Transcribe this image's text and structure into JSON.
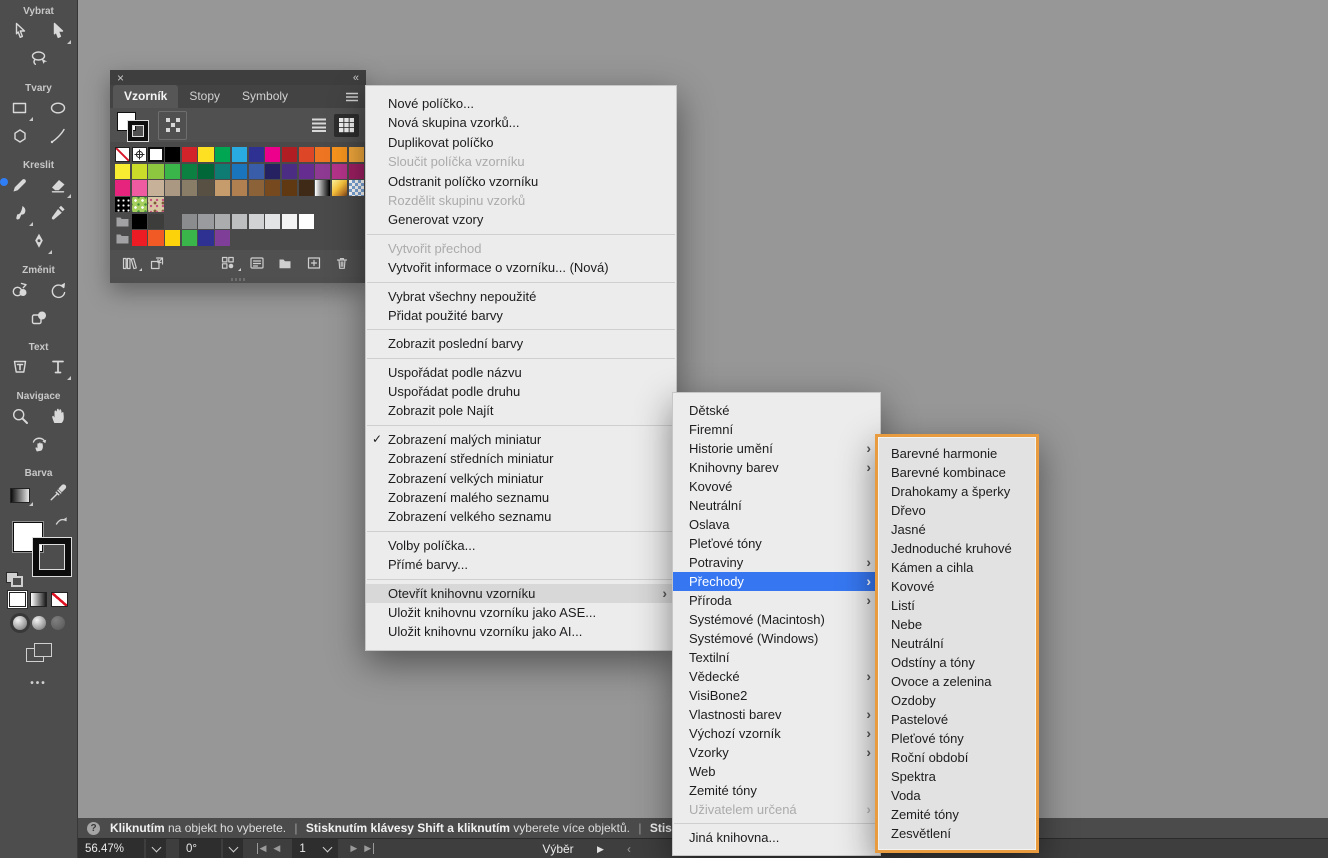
{
  "glyphs": {
    "close": "×",
    "collapse": "«",
    "check": "✓",
    "submenu_arrow": "›",
    "more_dots": "•••",
    "help": "?",
    "play": "▶",
    "back": "‹",
    "prev": "◀",
    "next": "▶"
  },
  "colors": {
    "accent_blue": "#3677f1",
    "highlight_orange": "#e89b3f",
    "canvas": "#979797",
    "chrome": "#4d4d4d",
    "menu_bg": "#ececec"
  },
  "toolbar": {
    "sections": [
      {
        "label": "Vybrat",
        "tools": [
          {
            "name": "direct-selection"
          },
          {
            "name": "selection",
            "corner": true
          },
          {
            "name": "lasso"
          }
        ]
      },
      {
        "label": "Tvary",
        "tools": [
          {
            "name": "rectangle",
            "corner": true
          },
          {
            "name": "ellipse"
          },
          {
            "name": "polygon"
          },
          {
            "name": "line"
          }
        ]
      },
      {
        "label": "Kreslit",
        "tools": [
          {
            "name": "pencil",
            "badge": true
          },
          {
            "name": "eraser",
            "corner": true
          },
          {
            "name": "paintbrush",
            "corner": true
          },
          {
            "name": "fountain-pen"
          },
          {
            "name": "pen",
            "corner": true
          }
        ]
      },
      {
        "label": "Změnit",
        "tools": [
          {
            "name": "shape-builder"
          },
          {
            "name": "rotate"
          },
          {
            "name": "transform"
          }
        ]
      },
      {
        "label": "Text",
        "tools": [
          {
            "name": "touch-type"
          },
          {
            "name": "type",
            "corner": true
          }
        ]
      },
      {
        "label": "Navigace",
        "tools": [
          {
            "name": "zoom"
          },
          {
            "name": "hand"
          },
          {
            "name": "rotate-view"
          }
        ]
      },
      {
        "label": "Barva",
        "tools": [
          {
            "name": "gradient",
            "corner": true
          },
          {
            "name": "eyedropper"
          }
        ]
      }
    ]
  },
  "panel": {
    "tabs": [
      {
        "label": "Vzorník",
        "active": true
      },
      {
        "label": "Stopy",
        "active": false
      },
      {
        "label": "Symboly",
        "active": false
      }
    ],
    "swatch_rows": [
      [
        "none",
        "registration",
        "selected-white",
        "#000000",
        "#d2232a",
        "#fde021",
        "#00a651",
        "#29abe2",
        "#2e3192",
        "#ec008c",
        "#b01e24",
        "#dd4727",
        "#ee7623",
        "#f7941d",
        "#f2a83b"
      ],
      [
        "#f9ed32",
        "#cbdb2a",
        "#8dc63f",
        "#39b54a",
        "#0c8040",
        "#006838",
        "#0f7c74",
        "#1b75bc",
        "#3a5da9",
        "#262262",
        "#4b2d83",
        "#662d91",
        "#8e3a93",
        "#b4338a",
        "#9e1f63"
      ],
      [
        "#e6247e",
        "#ef5ba1",
        "#c7b299",
        "#ab9882",
        "#8a7d68",
        "#575043",
        "#c69c6d",
        "#b08050",
        "#8c6239",
        "#77491f",
        "#603913",
        "#3f2a17",
        "gradient-bw",
        "gradient-gold",
        "pattern-blue"
      ],
      [
        "pattern-dots",
        "pattern-green",
        "pattern-floral",
        "",
        "",
        "",
        "",
        "",
        "",
        "",
        "",
        "",
        "",
        "",
        ""
      ],
      [
        "folder",
        "#000000",
        "#3d3d3c",
        "",
        "#8a8c8e",
        "#999b9e",
        "#aaacae",
        "#bcbec0",
        "#d0d2d3",
        "#e3e4e5",
        "#f3f3f3",
        "#ffffff",
        "",
        "",
        ""
      ],
      [
        "folder",
        "#ed1c24",
        "#f15a24",
        "#fcd20b",
        "#39b54a",
        "#2e3192",
        "#7f3f98",
        "",
        "",
        "",
        "",
        "",
        "",
        "",
        ""
      ]
    ],
    "footer_icons": [
      {
        "name": "swatch-libraries",
        "corner": true
      },
      {
        "name": "import-swatches",
        "corner": false
      },
      {
        "name": "swatch-kinds",
        "corner": true,
        "gap": true
      },
      {
        "name": "swatch-options",
        "corner": false
      },
      {
        "name": "new-color-group",
        "corner": false
      },
      {
        "name": "new-swatch",
        "corner": false
      },
      {
        "name": "delete-swatch",
        "corner": false
      }
    ]
  },
  "menu": {
    "items": [
      {
        "label": "Nové políčko..."
      },
      {
        "label": "Nová skupina vzorků..."
      },
      {
        "label": "Duplikovat políčko"
      },
      {
        "label": "Sloučit políčka vzorníku",
        "disabled": true
      },
      {
        "label": "Odstranit políčko vzorníku"
      },
      {
        "label": "Rozdělit skupinu vzorků",
        "disabled": true
      },
      {
        "label": "Generovat vzory"
      },
      {
        "separator": true
      },
      {
        "label": "Vytvořit přechod",
        "disabled": true
      },
      {
        "label": "Vytvořit informace o vzorníku... (Nová)"
      },
      {
        "separator": true
      },
      {
        "label": "Vybrat všechny nepoužité"
      },
      {
        "label": "Přidat použité barvy"
      },
      {
        "separator": true
      },
      {
        "label": "Zobrazit poslední barvy"
      },
      {
        "separator": true
      },
      {
        "label": "Uspořádat podle názvu"
      },
      {
        "label": "Uspořádat podle druhu"
      },
      {
        "label": "Zobrazit pole Najít"
      },
      {
        "separator": true
      },
      {
        "label": "Zobrazení malých miniatur",
        "checked": true
      },
      {
        "label": "Zobrazení středních miniatur"
      },
      {
        "label": "Zobrazení velkých miniatur"
      },
      {
        "label": "Zobrazení malého seznamu"
      },
      {
        "label": "Zobrazení velkého seznamu"
      },
      {
        "separator": true
      },
      {
        "label": "Volby políčka..."
      },
      {
        "label": "Přímé barvy..."
      },
      {
        "separator": true
      },
      {
        "label": "Otevřít knihovnu vzorníku",
        "submenu": true,
        "hover": true
      },
      {
        "label": "Uložit knihovnu vzorníku jako ASE..."
      },
      {
        "label": "Uložit knihovnu vzorníku jako AI..."
      }
    ]
  },
  "submenu": {
    "items": [
      {
        "label": "Dětské"
      },
      {
        "label": "Firemní"
      },
      {
        "label": "Historie umění",
        "submenu": true
      },
      {
        "label": "Knihovny barev",
        "submenu": true
      },
      {
        "label": "Kovové"
      },
      {
        "label": "Neutrální"
      },
      {
        "label": "Oslava"
      },
      {
        "label": "Pleťové tóny"
      },
      {
        "label": "Potraviny",
        "submenu": true
      },
      {
        "label": "Přechody",
        "submenu": true,
        "selected": true
      },
      {
        "label": "Příroda",
        "submenu": true
      },
      {
        "label": "Systémové (Macintosh)"
      },
      {
        "label": "Systémové (Windows)"
      },
      {
        "label": "Textilní"
      },
      {
        "label": "Vědecké",
        "submenu": true
      },
      {
        "label": "VisiBone2"
      },
      {
        "label": "Vlastnosti barev",
        "submenu": true
      },
      {
        "label": "Výchozí vzorník",
        "submenu": true
      },
      {
        "label": "Vzorky",
        "submenu": true
      },
      {
        "label": "Web"
      },
      {
        "label": "Zemité tóny"
      },
      {
        "label": "Uživatelem určená",
        "submenu": true,
        "disabled": true
      },
      {
        "separator": true
      },
      {
        "label": "Jiná knihovna..."
      }
    ]
  },
  "gradients_menu": {
    "items": [
      {
        "label": "Barevné harmonie"
      },
      {
        "label": "Barevné kombinace"
      },
      {
        "label": "Drahokamy a šperky"
      },
      {
        "label": "Dřevo"
      },
      {
        "label": "Jasné"
      },
      {
        "label": "Jednoduché kruhové"
      },
      {
        "label": "Kámen a cihla"
      },
      {
        "label": "Kovové"
      },
      {
        "label": "Listí"
      },
      {
        "label": "Nebe"
      },
      {
        "label": "Neutrální"
      },
      {
        "label": "Odstíny a tóny"
      },
      {
        "label": "Ovoce a zelenina"
      },
      {
        "label": "Ozdoby"
      },
      {
        "label": "Pastelové"
      },
      {
        "label": "Pleťové tóny"
      },
      {
        "label": "Roční období"
      },
      {
        "label": "Spektra"
      },
      {
        "label": "Voda"
      },
      {
        "label": "Zemité tóny"
      },
      {
        "label": "Zesvětlení"
      }
    ]
  },
  "statusbar": {
    "tip": [
      {
        "text": "Kliknutím",
        "bold": true
      },
      {
        "text": " na objekt ho vyberete. ",
        "bold": false
      },
      {
        "text": "|",
        "bold": false,
        "sep": true
      },
      {
        "text": " Stisknutím klávesy Shift a kliknutím",
        "bold": true
      },
      {
        "text": " vyberete více objektů. ",
        "bold": false
      },
      {
        "text": "|",
        "bold": false,
        "sep": true
      },
      {
        "text": " Stisknutí",
        "bold": true
      }
    ],
    "zoom_value": "56.47%",
    "rotation_value": "0°",
    "page_value": "1",
    "tool_label": "Výběr"
  }
}
